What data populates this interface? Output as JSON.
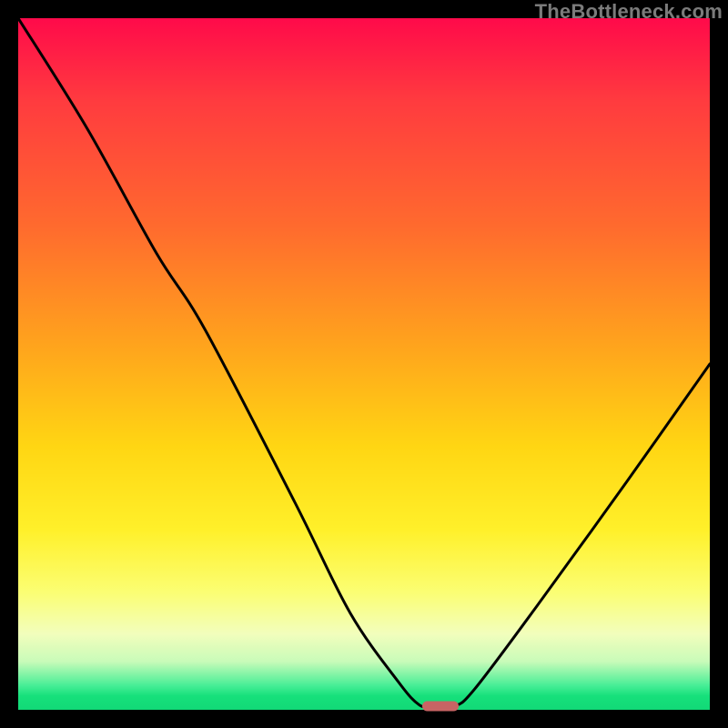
{
  "watermark": "TheBottleneck.com",
  "chart_data": {
    "type": "line",
    "title": "",
    "xlabel": "",
    "ylabel": "",
    "xlim": [
      0,
      100
    ],
    "ylim": [
      0,
      100
    ],
    "series": [
      {
        "name": "bottleneck-curve",
        "x": [
          0,
          10,
          20,
          27,
          40,
          48,
          55,
          58,
          60,
          63,
          66,
          75,
          88,
          100
        ],
        "y": [
          100,
          84,
          66,
          55,
          30,
          14,
          4,
          0.7,
          0.5,
          0.5,
          3,
          15,
          33,
          50
        ]
      }
    ],
    "marker": {
      "x": 61,
      "y": 0.5,
      "color": "#c86464"
    },
    "gradient_stops": [
      {
        "pos": 0.0,
        "color": "#ff0a4a"
      },
      {
        "pos": 0.12,
        "color": "#ff3b3f"
      },
      {
        "pos": 0.3,
        "color": "#ff6a2e"
      },
      {
        "pos": 0.48,
        "color": "#ffa61c"
      },
      {
        "pos": 0.62,
        "color": "#ffd613"
      },
      {
        "pos": 0.74,
        "color": "#fff02a"
      },
      {
        "pos": 0.83,
        "color": "#fbfe73"
      },
      {
        "pos": 0.89,
        "color": "#f2febc"
      },
      {
        "pos": 0.93,
        "color": "#c9fbb9"
      },
      {
        "pos": 0.965,
        "color": "#47ee96"
      },
      {
        "pos": 0.98,
        "color": "#16e07b"
      },
      {
        "pos": 1.0,
        "color": "#12d977"
      }
    ]
  }
}
